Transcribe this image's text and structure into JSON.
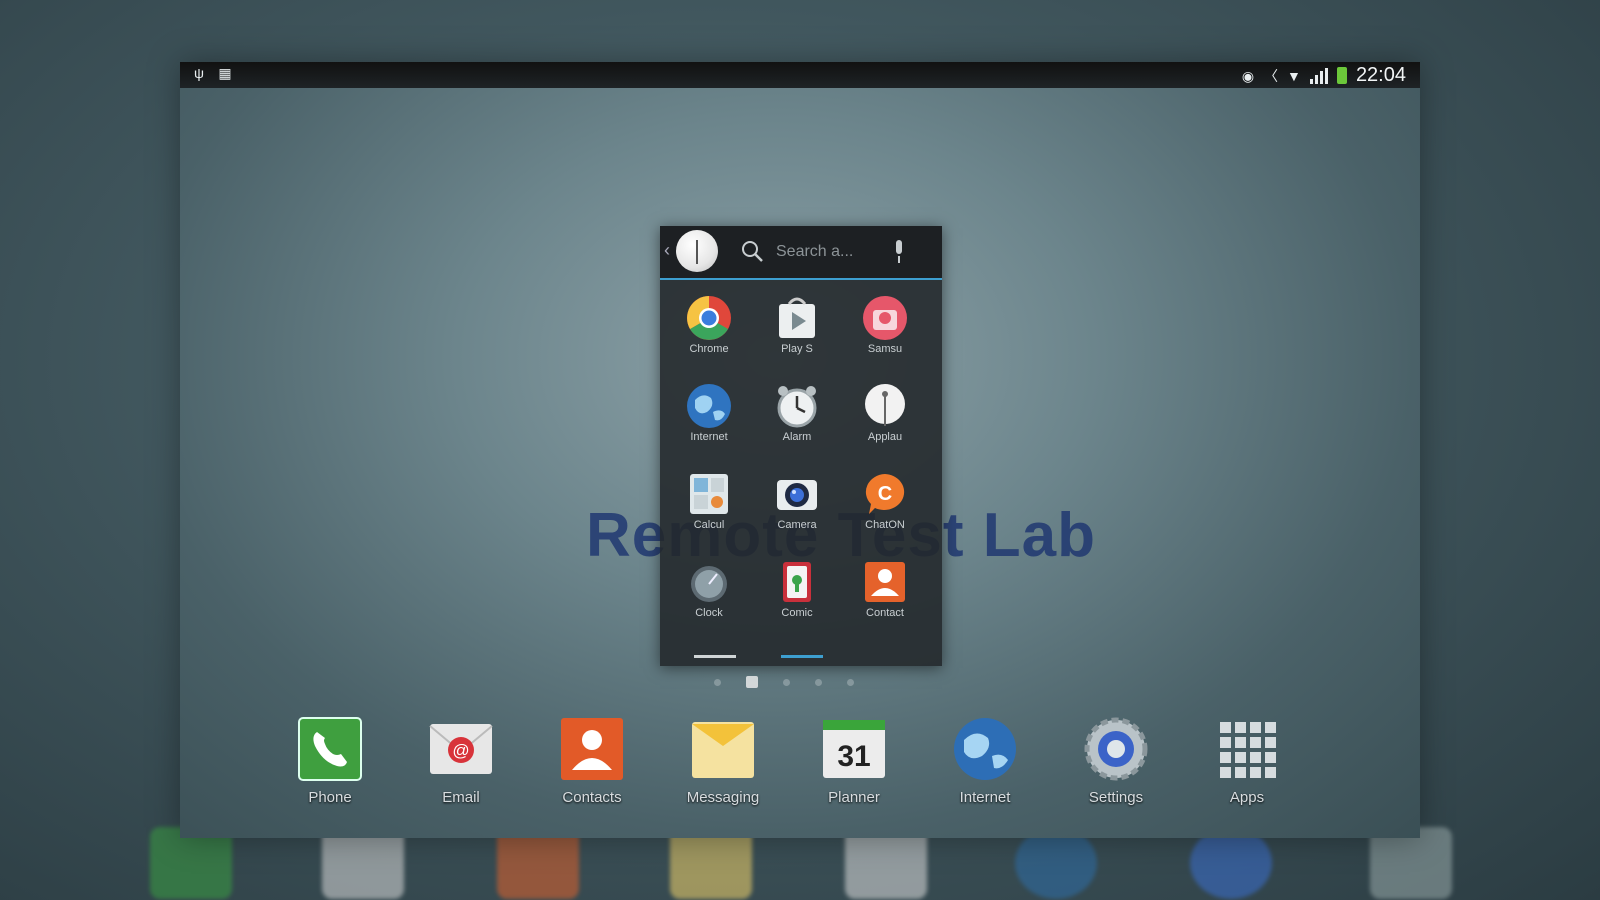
{
  "status_bar": {
    "time": "22:04",
    "left_icons": [
      "usb-icon",
      "sd-card-icon"
    ],
    "right_icons": [
      "eye-icon",
      "mute-icon",
      "wifi-icon",
      "signal-icon",
      "battery-icon"
    ]
  },
  "watermark": "Remote Test Lab",
  "drawer": {
    "search_placeholder": "Search a...",
    "apps": [
      {
        "label": "Chrome",
        "icon": "chrome-icon"
      },
      {
        "label": "Play S",
        "icon": "play-store-icon"
      },
      {
        "label": "Samsu",
        "icon": "samsung-apps-icon"
      },
      {
        "label": "Internet",
        "icon": "internet-icon"
      },
      {
        "label": "Alarm",
        "icon": "alarm-icon"
      },
      {
        "label": "Applau",
        "icon": "applauncher-icon"
      },
      {
        "label": "Calcul",
        "icon": "calculator-icon"
      },
      {
        "label": "Camera",
        "icon": "camera-icon"
      },
      {
        "label": "ChatON",
        "icon": "chaton-icon"
      },
      {
        "label": "Clock",
        "icon": "clock-icon"
      },
      {
        "label": "Comic",
        "icon": "cards-icon"
      },
      {
        "label": "Contact",
        "icon": "contacts-icon"
      }
    ]
  },
  "home_pages": {
    "count": 5,
    "active": 1
  },
  "dock": [
    {
      "label": "Phone",
      "icon": "phone-icon"
    },
    {
      "label": "Email",
      "icon": "email-icon"
    },
    {
      "label": "Contacts",
      "icon": "contacts-icon"
    },
    {
      "label": "Messaging",
      "icon": "messaging-icon"
    },
    {
      "label": "Planner",
      "icon": "calendar-icon",
      "date": "31"
    },
    {
      "label": "Internet",
      "icon": "internet-icon"
    },
    {
      "label": "Settings",
      "icon": "settings-icon"
    },
    {
      "label": "Apps",
      "icon": "apps-grid-icon"
    }
  ],
  "colors": {
    "accent": "#3d9fd0",
    "battery": "#6cc83a"
  }
}
